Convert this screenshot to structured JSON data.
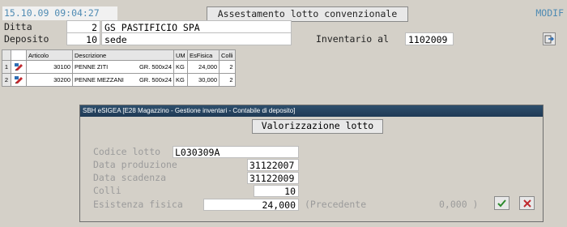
{
  "header": {
    "datetime": "15.10.09 09:04:27",
    "title": "Assestamento lotto convenzionale",
    "mode": "MODIF"
  },
  "form": {
    "ditta_label": "Ditta",
    "ditta_code": "2",
    "ditta_name": "GS PASTIFICIO SPA",
    "deposito_label": "Deposito",
    "deposito_code": "10",
    "deposito_name": "sede",
    "inventario_label": "Inventario al",
    "inventario_value": "1102009"
  },
  "grid": {
    "columns": [
      "Articolo",
      "Descrizione",
      "UM",
      "EsFisica",
      "Colli"
    ],
    "rows": [
      {
        "n": "1",
        "articolo": "30100",
        "descrizione": "PENNE ZITI",
        "formato": "GR. 500x24",
        "um": "KG",
        "esfisica": "24,000",
        "colli": "2"
      },
      {
        "n": "2",
        "articolo": "30200",
        "descrizione": "PENNE MEZZANI",
        "formato": "GR. 500x24",
        "um": "KG",
        "esfisica": "30,000",
        "colli": "2"
      }
    ]
  },
  "dialog": {
    "title": "SBH eSIGEA [E28 Magazzino - Gestione inventari - Contabile di deposito]",
    "subtitle": "Valorizzazione lotto",
    "codice_lotto_label": "Codice lotto",
    "codice_lotto": "L030309A",
    "data_produzione_label": "Data produzione",
    "data_produzione": "31122007",
    "data_scadenza_label": "Data scadenza",
    "data_scadenza": "31122009",
    "colli_label": "Colli",
    "colli": "10",
    "esistenza_label": "Esistenza fisica",
    "esistenza": "24,000",
    "precedente_label": "(Precedente",
    "precedente_value": "0,000 )"
  },
  "colors": {
    "accent_text": "#4f8bb3",
    "titlebar": "#1f3a55",
    "confirm": "#2c8a2c",
    "cancel": "#c0282d"
  }
}
